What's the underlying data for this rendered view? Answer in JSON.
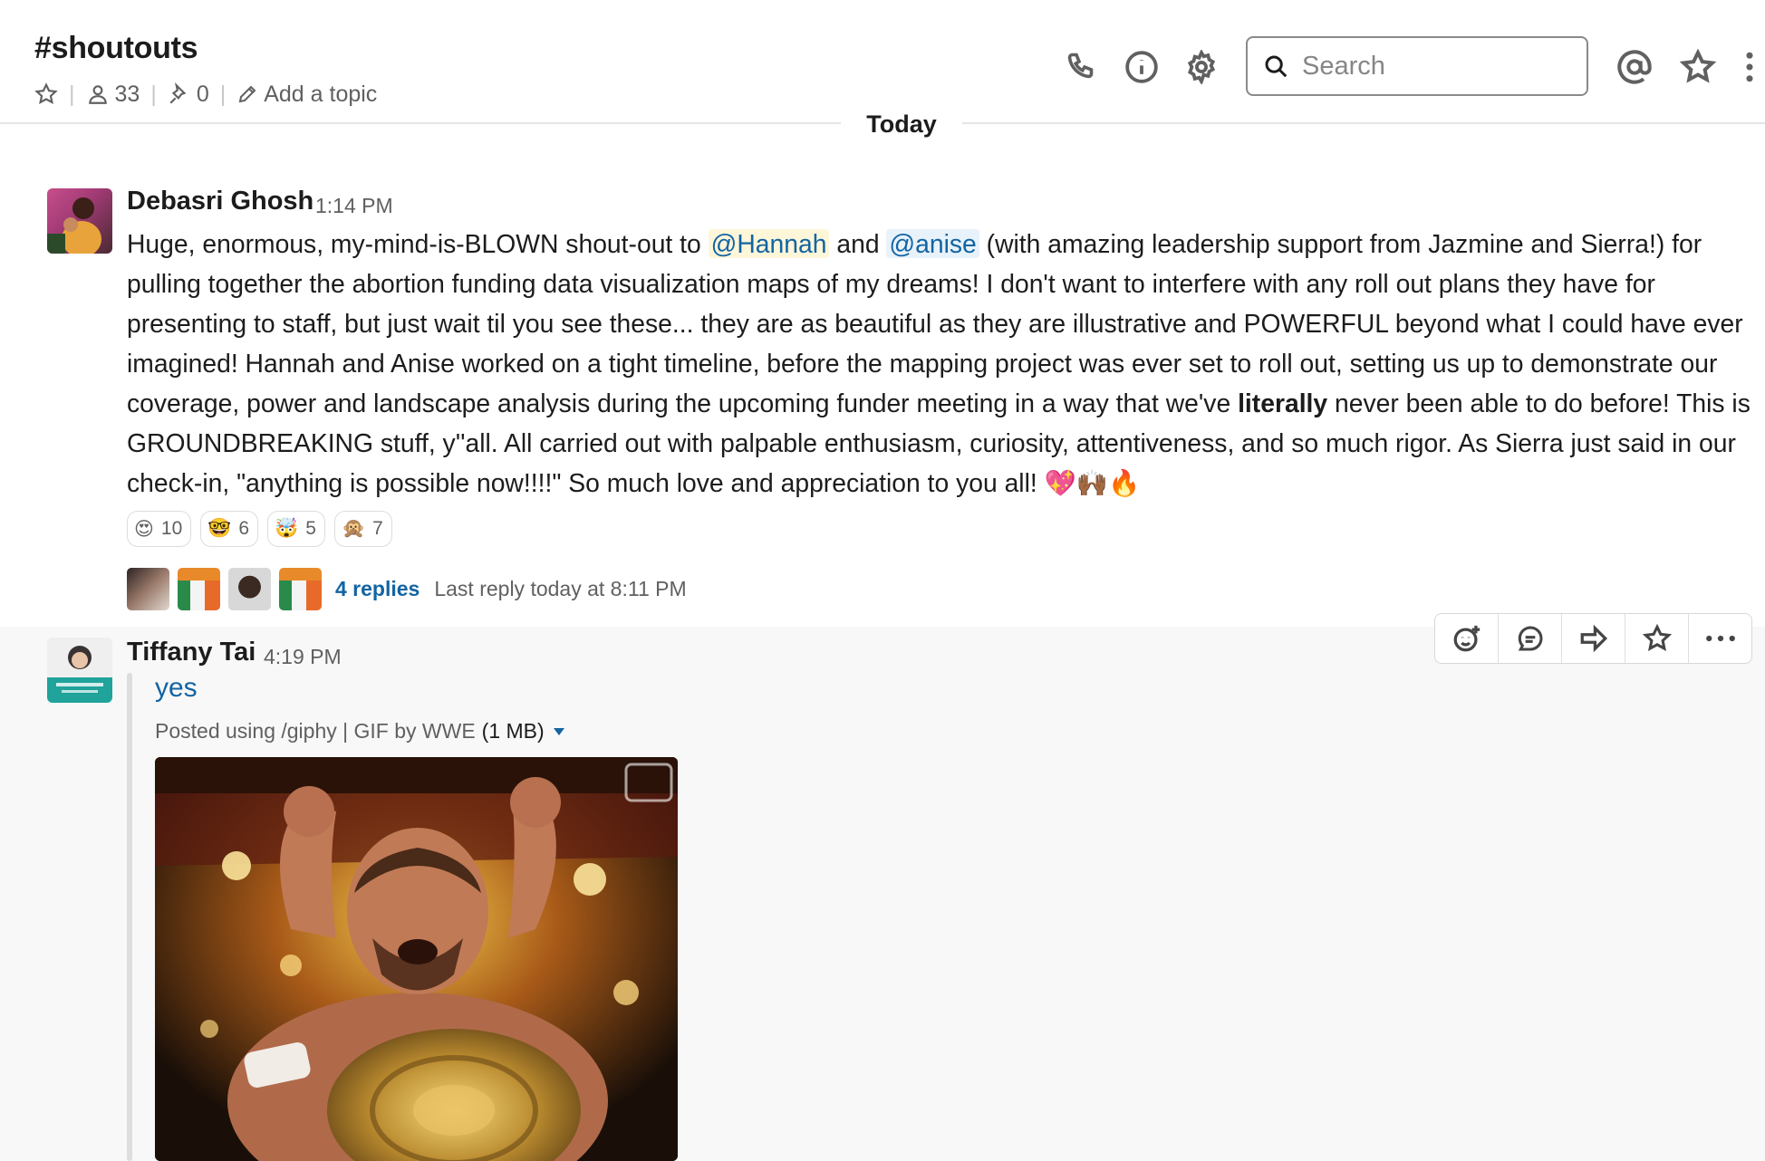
{
  "header": {
    "channel_name": "#shoutouts",
    "member_count": "33",
    "pinned_count": "0",
    "topic_placeholder": "Add a topic",
    "search_placeholder": "Search"
  },
  "divider": {
    "label": "Today"
  },
  "messages": [
    {
      "sender": "Debasri Ghosh",
      "time": "1:14 PM",
      "text_1": "Huge, enormous, my-mind-is-BLOWN shout-out to ",
      "mention_1": "@Hannah",
      "text_2": " and ",
      "mention_2": "@anise",
      "text_3": " (with amazing leadership support from Jazmine and Sierra!) for pulling together the abortion funding data visualization maps of my dreams! I don't want to interfere with any roll out plans they have for presenting to staff, but just wait til you see these... they are as beautiful as they are illustrative and POWERFUL beyond what I could have ever imagined! Hannah and Anise worked on a tight timeline, before the mapping project was ever set to roll out, setting us up to demonstrate our coverage, power and landscape analysis during the upcoming funder meeting in a way that we've ",
      "bold_word": "literally",
      "text_4": " never been able to do before! This is GROUNDBREAKING stuff, y''all. All carried out with palpable enthusiasm, curiosity, attentiveness, and so much rigor.  As Sierra just said in our check-in, \"anything is possible now!!!!\" So much love and appreciation to you all! ",
      "trailing_emoji": "💖🙌🏾🔥",
      "reactions": [
        {
          "emoji": "😍",
          "count": "10"
        },
        {
          "emoji": "🤓",
          "count": "6"
        },
        {
          "emoji": "🤯",
          "count": "5"
        },
        {
          "emoji": "🙊",
          "count": "7"
        }
      ],
      "thread": {
        "replies": "4 replies",
        "last_reply": "Last reply today at 8:11 PM"
      }
    },
    {
      "sender": "Tiffany Tai",
      "time": "4:19 PM",
      "attachment": {
        "title": "yes",
        "source": "Posted using /giphy | GIF by WWE",
        "size": "(1 MB)"
      }
    }
  ],
  "icons": {
    "header": [
      "star-icon",
      "member-icon",
      "pin-icon",
      "pencil-icon",
      "phone-icon",
      "info-icon",
      "gear-icon",
      "search-icon",
      "mention-icon",
      "star-icon",
      "more-vertical-icon"
    ],
    "actions": [
      "add-reaction-icon",
      "reply-thread-icon",
      "share-icon",
      "star-icon",
      "more-icon"
    ]
  },
  "colors": {
    "link": "#1264a3",
    "mention_bg": "#fdf6d9",
    "hover_bg": "#f8f8f8"
  }
}
